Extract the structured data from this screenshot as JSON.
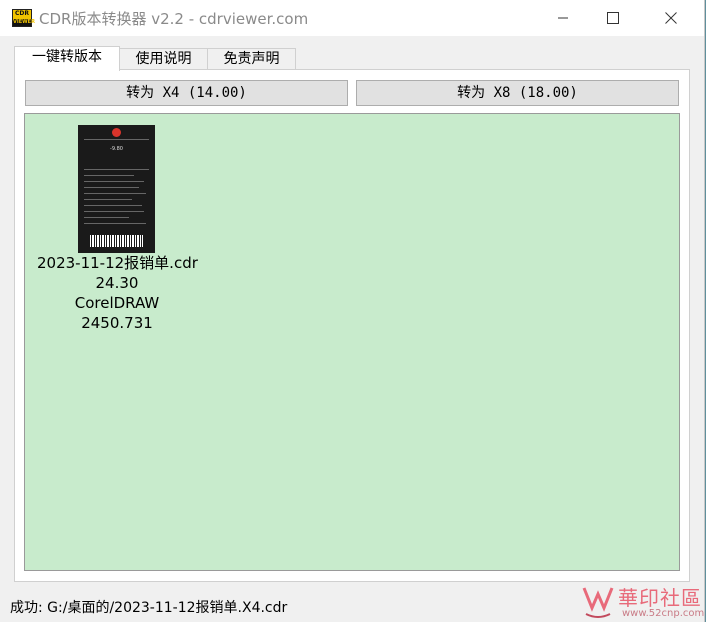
{
  "window": {
    "title": "CDR版本转换器 v2.2 - cdrviewer.com",
    "icon": {
      "top_text": "CDR",
      "bottom_text": "VIEWER"
    }
  },
  "tabs": [
    {
      "label": "一键转版本",
      "active": true
    },
    {
      "label": "使用说明",
      "active": false
    },
    {
      "label": "免责声明",
      "active": false
    }
  ],
  "buttons": {
    "convert_x4": "转为 X4 (14.00)",
    "convert_x8": "转为 X8 (18.00)"
  },
  "file": {
    "name": "2023-11-12报销单.cdr",
    "version": "24.30",
    "app": "CorelDRAW",
    "size": "2450.731",
    "thumb_amount": "-9.80"
  },
  "status": {
    "text": "成功: G:/桌面的/2023-11-12报销单.X4.cdr"
  },
  "watermark": {
    "text": "華印社區",
    "url": "www.52cnp.com"
  },
  "colors": {
    "drop_area": "#c8ebcc",
    "button": "#e1e1e1",
    "app_icon": "#f2c400"
  }
}
